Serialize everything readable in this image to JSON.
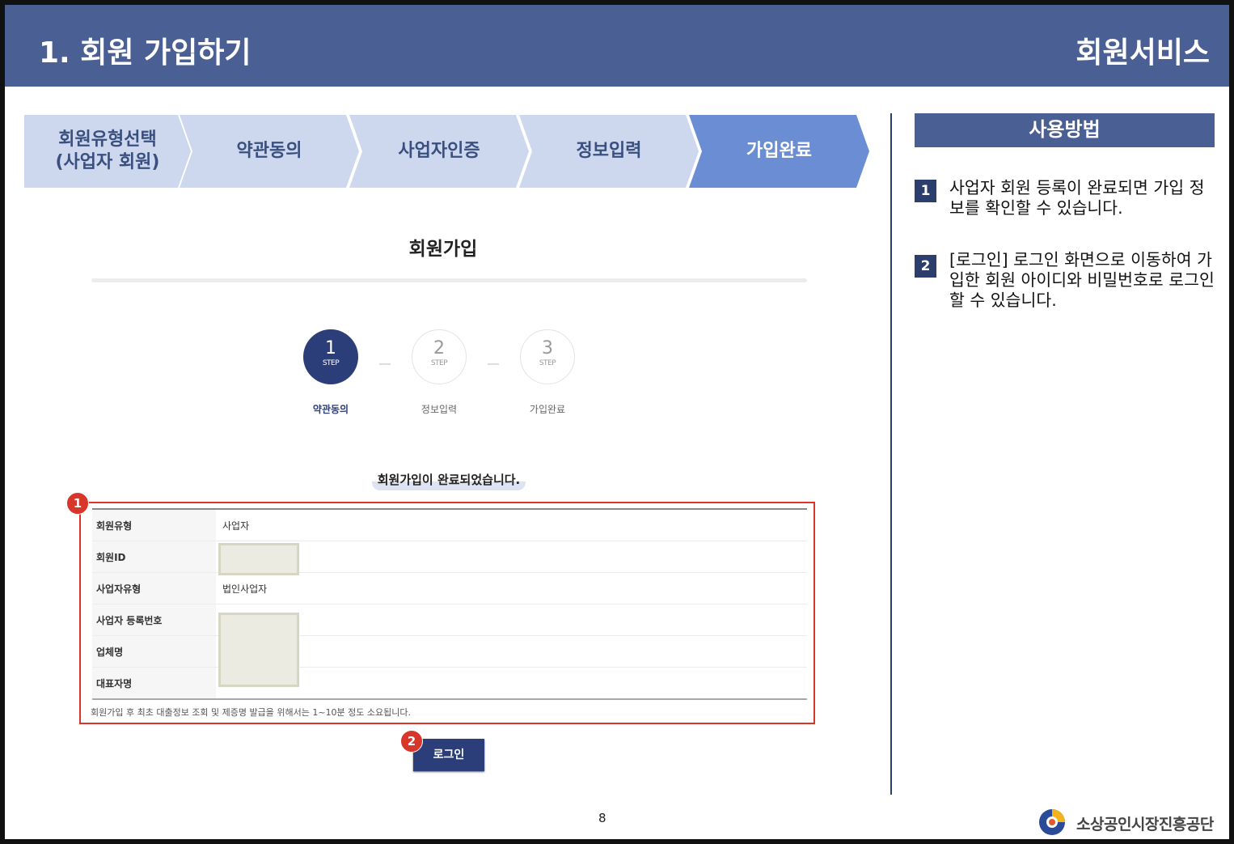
{
  "header": {
    "title": "1. 회원 가입하기",
    "service": "회원서비스"
  },
  "process_steps": [
    {
      "label": "회원유형선택\n(사업자 회원)",
      "state": "inactive"
    },
    {
      "label": "약관동의",
      "state": "inactive"
    },
    {
      "label": "사업자인증",
      "state": "inactive"
    },
    {
      "label": "정보입력",
      "state": "inactive"
    },
    {
      "label": "가입완료",
      "state": "active"
    }
  ],
  "howto": {
    "heading": "사용방법",
    "items": [
      {
        "num": "1",
        "text": "사업자 회원 등록이 완료되면 가입 정보를 확인할 수 있습니다."
      },
      {
        "num": "2",
        "text": "[로그인] 로그인 화면으로 이동하여 가입한 회원 아이디와 비밀번호로 로그인할 수 있습니다."
      }
    ]
  },
  "screen": {
    "title": "회원가입",
    "steps": [
      {
        "num": "1",
        "sub": "STEP",
        "label": "약관동의",
        "active": true
      },
      {
        "num": "2",
        "sub": "STEP",
        "label": "정보입력",
        "active": false
      },
      {
        "num": "3",
        "sub": "STEP",
        "label": "가입완료",
        "active": false
      }
    ],
    "complete_message": "회원가입이 완료되었습니다.",
    "info_rows": [
      {
        "label": "회원유형",
        "value": "사업자"
      },
      {
        "label": "회원ID",
        "value": ""
      },
      {
        "label": "사업자유형",
        "value": "법인사업자"
      },
      {
        "label": "사업자 등록번호",
        "value": ""
      },
      {
        "label": "업체명",
        "value": ""
      },
      {
        "label": "대표자명",
        "value": ""
      }
    ],
    "note": "회원가입 후 최초 대출정보 조회 및 제증명 발급을 위해서는 1~10분 정도 소요됩니다.",
    "login_button": "로그인",
    "badges": [
      "1",
      "2"
    ]
  },
  "footer": {
    "page_number": "8",
    "org_name": "소상공인시장진흥공단"
  },
  "colors": {
    "header_bg": "#4a5f93",
    "step_light": "#cdd8ee",
    "step_active": "#6b8dd3",
    "highlight_red": "#d9362b",
    "navy": "#2c3e7a"
  }
}
